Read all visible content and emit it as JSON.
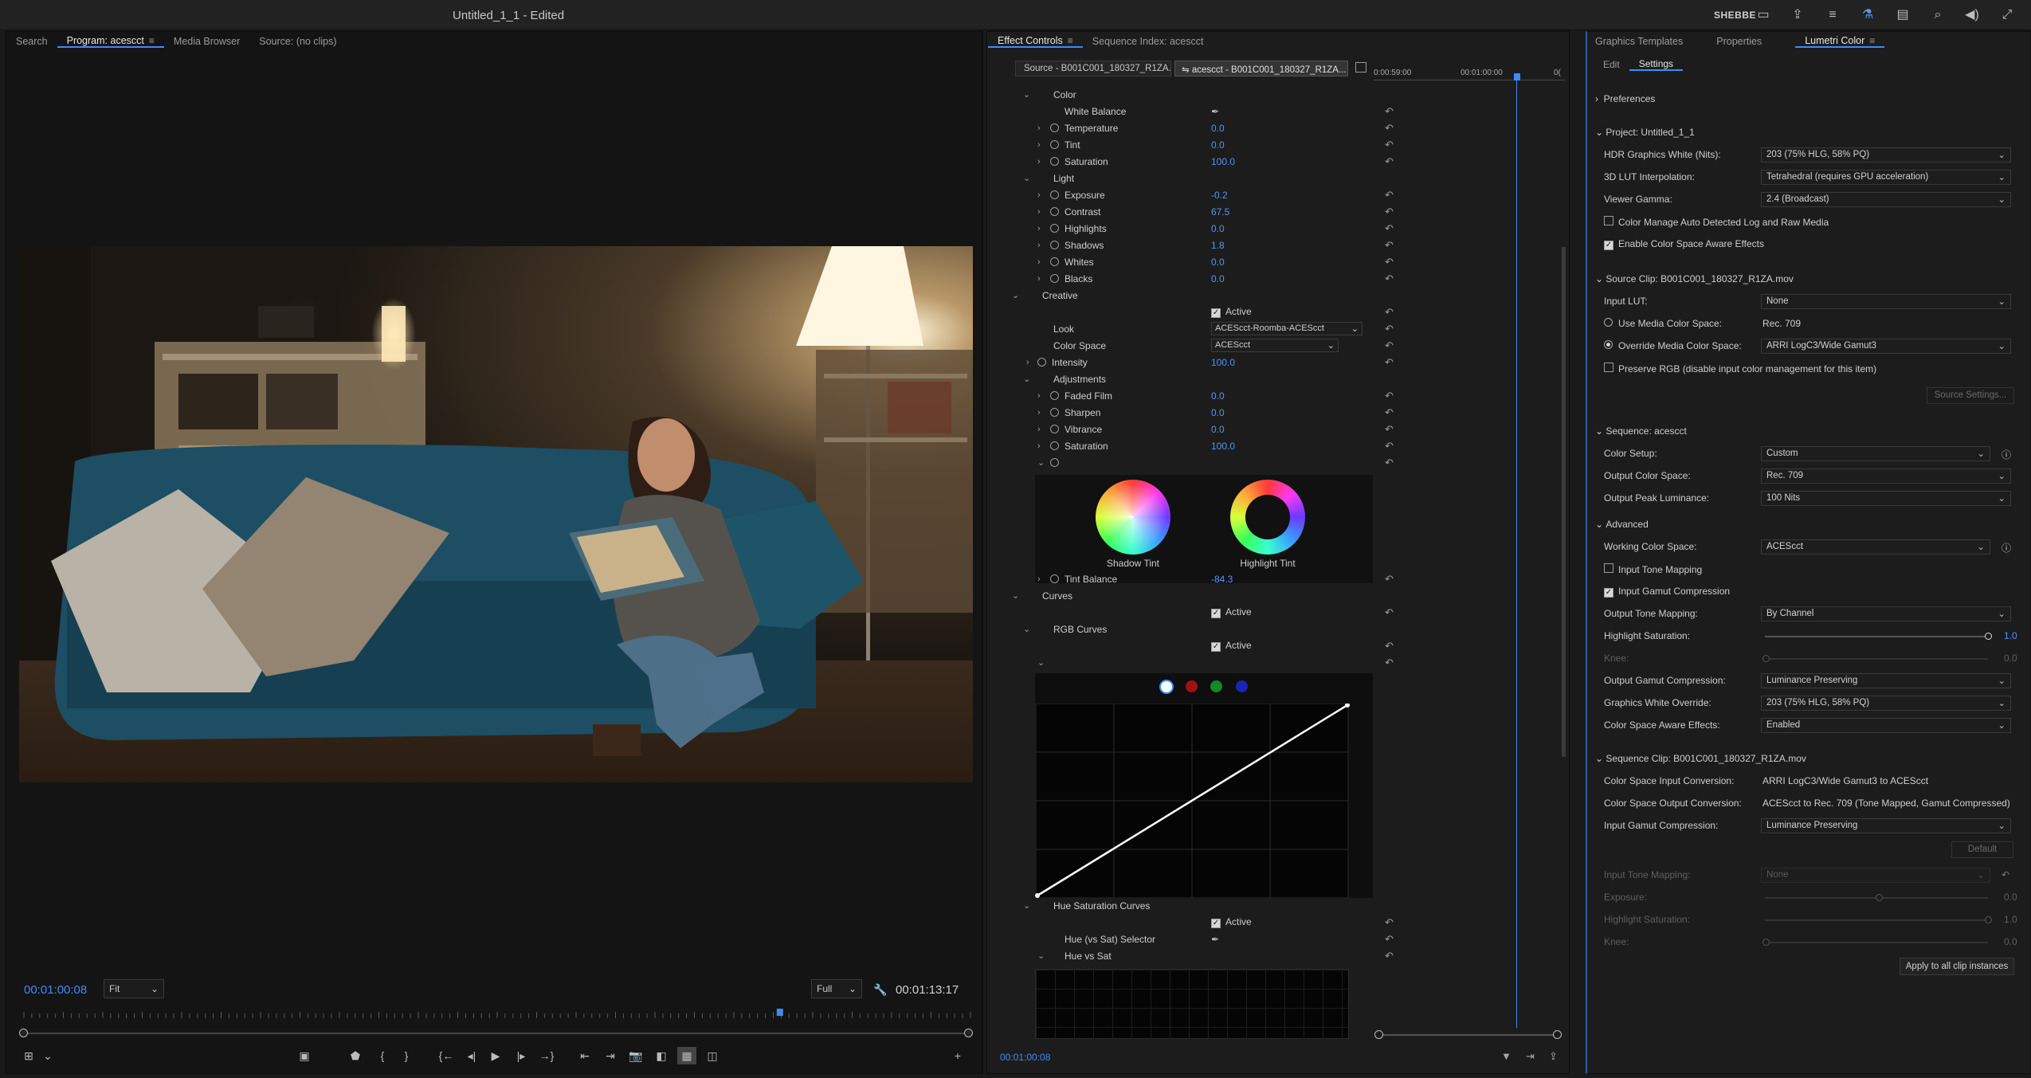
{
  "app": {
    "title": "Untitled_1_1 - Edited",
    "user": "SHEBBE"
  },
  "program_panel": {
    "tabs": [
      "Search",
      "Program: acescct",
      "Media Browser",
      "Source: (no clips)"
    ],
    "timecode_current": "00:01:00:08",
    "zoom": "Fit",
    "resolution": "Full",
    "timecode_duration": "00:01:13:17",
    "playhead_fraction": 0.8
  },
  "effect_controls": {
    "tabs": [
      "Effect Controls",
      "Sequence Index: acescct"
    ],
    "clip_source": "Source - B001C001_180327_R1ZA...",
    "clip_seq": "acescct - B001C001_180327_R1ZA...",
    "timeline_ruler": [
      "0:00:59:00",
      "00:01:00:00",
      "0("
    ],
    "timecode": "00:01:00:08",
    "color_section": "Color",
    "white_balance": "White Balance",
    "temperature": {
      "label": "Temperature",
      "value": "0.0"
    },
    "tint": {
      "label": "Tint",
      "value": "0.0"
    },
    "saturation1": {
      "label": "Saturation",
      "value": "100.0"
    },
    "light_section": "Light",
    "exposure": {
      "label": "Exposure",
      "value": "-0.2"
    },
    "contrast": {
      "label": "Contrast",
      "value": "67.5"
    },
    "highlights": {
      "label": "Highlights",
      "value": "0.0"
    },
    "shadows": {
      "label": "Shadows",
      "value": "1.8"
    },
    "whites": {
      "label": "Whites",
      "value": "0.0"
    },
    "blacks": {
      "label": "Blacks",
      "value": "0.0"
    },
    "creative_section": "Creative",
    "active_label": "Active",
    "look": {
      "label": "Look",
      "value": "ACEScct-Roomba-ACEScct"
    },
    "color_space": {
      "label": "Color Space",
      "value": "ACEScct"
    },
    "intensity": {
      "label": "Intensity",
      "value": "100.0"
    },
    "adjustments_section": "Adjustments",
    "faded_film": {
      "label": "Faded Film",
      "value": "0.0"
    },
    "sharpen": {
      "label": "Sharpen",
      "value": "0.0"
    },
    "vibrance": {
      "label": "Vibrance",
      "value": "0.0"
    },
    "saturation2": {
      "label": "Saturation",
      "value": "100.0"
    },
    "shadow_tint": "Shadow Tint",
    "highlight_tint": "Highlight Tint",
    "tint_balance": {
      "label": "Tint Balance",
      "value": "-84.3"
    },
    "curves_section": "Curves",
    "rgb_curves": "RGB Curves",
    "hue_sat_curves": "Hue Saturation Curves",
    "hue_selector": "Hue (vs Sat) Selector",
    "hue_vs_sat": "Hue vs Sat"
  },
  "lumetri": {
    "tabs": [
      "Graphics Templates",
      "Properties",
      "Lumetri Color"
    ],
    "subtabs": [
      "Edit",
      "Settings"
    ],
    "preferences": "Preferences",
    "project": "Project: Untitled_1_1",
    "hdr_white": {
      "label": "HDR Graphics White (Nits):",
      "value": "203 (75% HLG, 58% PQ)"
    },
    "lut_interp": {
      "label": "3D LUT Interpolation:",
      "value": "Tetrahedral (requires GPU acceleration)"
    },
    "viewer_gamma": {
      "label": "Viewer Gamma:",
      "value": "2.4 (Broadcast)"
    },
    "cm_auto": "Color Manage Auto Detected Log and Raw Media",
    "cs_aware": "Enable Color Space Aware Effects",
    "source_clip": "Source Clip: B001C001_180327_R1ZA.mov",
    "input_lut": {
      "label": "Input LUT:",
      "value": "None"
    },
    "use_media": {
      "label": "Use Media Color Space:",
      "value": "Rec. 709"
    },
    "override_media": {
      "label": "Override Media Color Space:",
      "value": "ARRI LogC3/Wide Gamut3"
    },
    "preserve_rgb": "Preserve RGB (disable input color management for this item)",
    "source_settings": "Source Settings...",
    "sequence": "Sequence: acescct",
    "color_setup": {
      "label": "Color Setup:",
      "value": "Custom"
    },
    "output_cs": {
      "label": "Output Color Space:",
      "value": "Rec. 709"
    },
    "peak_lum": {
      "label": "Output Peak Luminance:",
      "value": "100 Nits"
    },
    "advanced": "Advanced",
    "working_cs": {
      "label": "Working Color Space:",
      "value": "ACEScct"
    },
    "input_tone": "Input Tone Mapping",
    "input_gamut": "Input Gamut Compression",
    "output_tone": {
      "label": "Output Tone Mapping:",
      "value": "By Channel"
    },
    "highlight_sat": {
      "label": "Highlight Saturation:",
      "value": "1.0"
    },
    "knee": {
      "label": "Knee:",
      "value": "0.0"
    },
    "out_gamut": {
      "label": "Output Gamut Compression:",
      "value": "Luminance Preserving"
    },
    "gfx_white": {
      "label": "Graphics White Override:",
      "value": "203 (75% HLG, 58% PQ)"
    },
    "cs_aware_fx": {
      "label": "Color Space Aware Effects:",
      "value": "Enabled"
    },
    "seq_clip": "Sequence Clip: B001C001_180327_R1ZA.mov",
    "cs_in_conv": {
      "label": "Color Space Input Conversion:",
      "value": "ARRI LogC3/Wide Gamut3 to ACEScct"
    },
    "cs_out_conv": {
      "label": "Color Space Output Conversion:",
      "value": "ACEScct to Rec. 709 (Tone Mapped, Gamut Compressed)"
    },
    "in_gamut_comp": {
      "label": "Input Gamut Compression:",
      "value": "Luminance Preserving"
    },
    "default_btn": "Default",
    "in_tone_map": {
      "label": "Input Tone Mapping:",
      "value": "None"
    },
    "exposure": {
      "label": "Exposure:",
      "value": "0.0"
    },
    "hl_sat2": {
      "label": "Highlight Saturation:",
      "value": "1.0"
    },
    "knee2": {
      "label": "Knee:",
      "value": "0.0"
    },
    "apply_all": "Apply to all clip instances"
  }
}
